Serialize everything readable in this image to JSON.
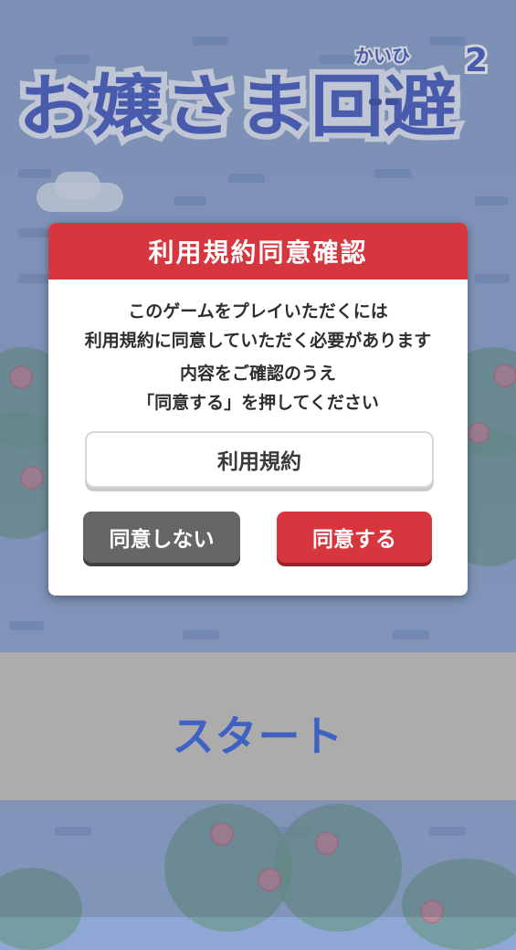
{
  "logo": {
    "title": "お嬢さま回避",
    "ruby": "かいひ",
    "number": "2"
  },
  "dialog": {
    "title": "利用規約同意確認",
    "lines": [
      "このゲームをプレイいただくには",
      "利用規約に同意していただく必要があります",
      "内容をご確認のうえ",
      "「同意する」を押してください"
    ],
    "terms_button": "利用規約",
    "disagree_button": "同意しない",
    "agree_button": "同意する"
  },
  "start": {
    "label": "スタート"
  },
  "colors": {
    "header_red": "#d6373f",
    "disagree_gray": "#666666",
    "start_blue": "#3e62c4",
    "logo_blue": "#4a5fc4"
  }
}
